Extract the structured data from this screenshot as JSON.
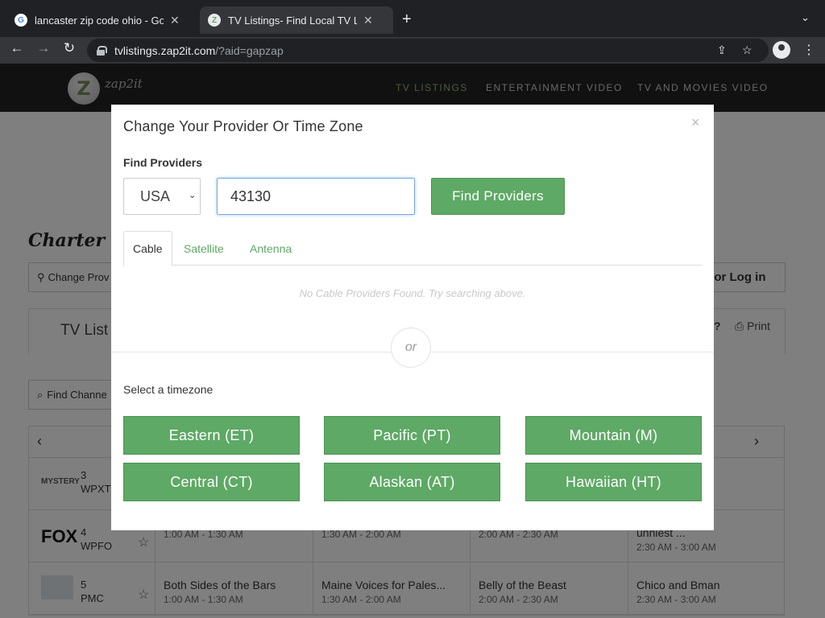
{
  "browser": {
    "tabs": [
      {
        "title": "lancaster zip code ohio - Goog",
        "favicon": "G",
        "active": false
      },
      {
        "title": "TV Listings- Find Local TV List",
        "favicon": "Z",
        "active": true
      }
    ],
    "url_host": "tvlistings.zap2it.com",
    "url_path": "/?aid=gapzap"
  },
  "site": {
    "logo_text": "zap2it",
    "logo_letter": "Z",
    "nav": [
      "TV LISTINGS",
      "ENTERTAINMENT VIDEO",
      "TV AND MOVIES VIDEO"
    ],
    "provider_title": "Charter S",
    "change_provider_label": "Change Prov",
    "login_label": "p or Log in",
    "listings_label": "TV List",
    "help_label": "?",
    "print_label": "Print",
    "find_channel_label": "Find Channe",
    "rows": [
      {
        "logo": "MYSTERY",
        "number": "3",
        "callsign": "WPXT",
        "shows": []
      },
      {
        "logo": "FOX",
        "number": "4",
        "callsign": "WPFO",
        "shows": [
          {
            "title": "",
            "time": "1:00 AM - 1:30 AM"
          },
          {
            "title": "",
            "time": "1:30 AM - 2:00 AM"
          },
          {
            "title": "",
            "time": "2:00 AM - 2:30 AM"
          },
          {
            "title": "unniest ...",
            "time": "2:30 AM - 3:00 AM"
          }
        ]
      },
      {
        "logo": "",
        "number": "5",
        "callsign": "PMC",
        "shows": [
          {
            "title": "Both Sides of the Bars",
            "time": "1:00 AM - 1:30 AM"
          },
          {
            "title": "Maine Voices for Pales...",
            "time": "1:30 AM - 2:00 AM"
          },
          {
            "title": "Belly of the Beast",
            "time": "2:00 AM - 2:30 AM"
          },
          {
            "title": "Chico and Bman",
            "time": "2:30 AM - 3:00 AM"
          }
        ]
      }
    ]
  },
  "modal": {
    "title": "Change Your Provider Or Time Zone",
    "close": "×",
    "find_label": "Find Providers",
    "country": "USA",
    "zip_value": "43130",
    "find_button": "Find Providers",
    "tabs": [
      "Cable",
      "Satellite",
      "Antenna"
    ],
    "no_providers": "No Cable Providers Found. Try searching above.",
    "or_label": "or",
    "timezone_label": "Select a timezone",
    "timezones": [
      "Eastern (ET)",
      "Pacific (PT)",
      "Mountain (M)",
      "Central (CT)",
      "Alaskan (AT)",
      "Hawaiian (HT)"
    ]
  },
  "colors": {
    "accent_green": "#5ea965",
    "nav_active": "#94b96b",
    "header_dark": "#222222"
  }
}
